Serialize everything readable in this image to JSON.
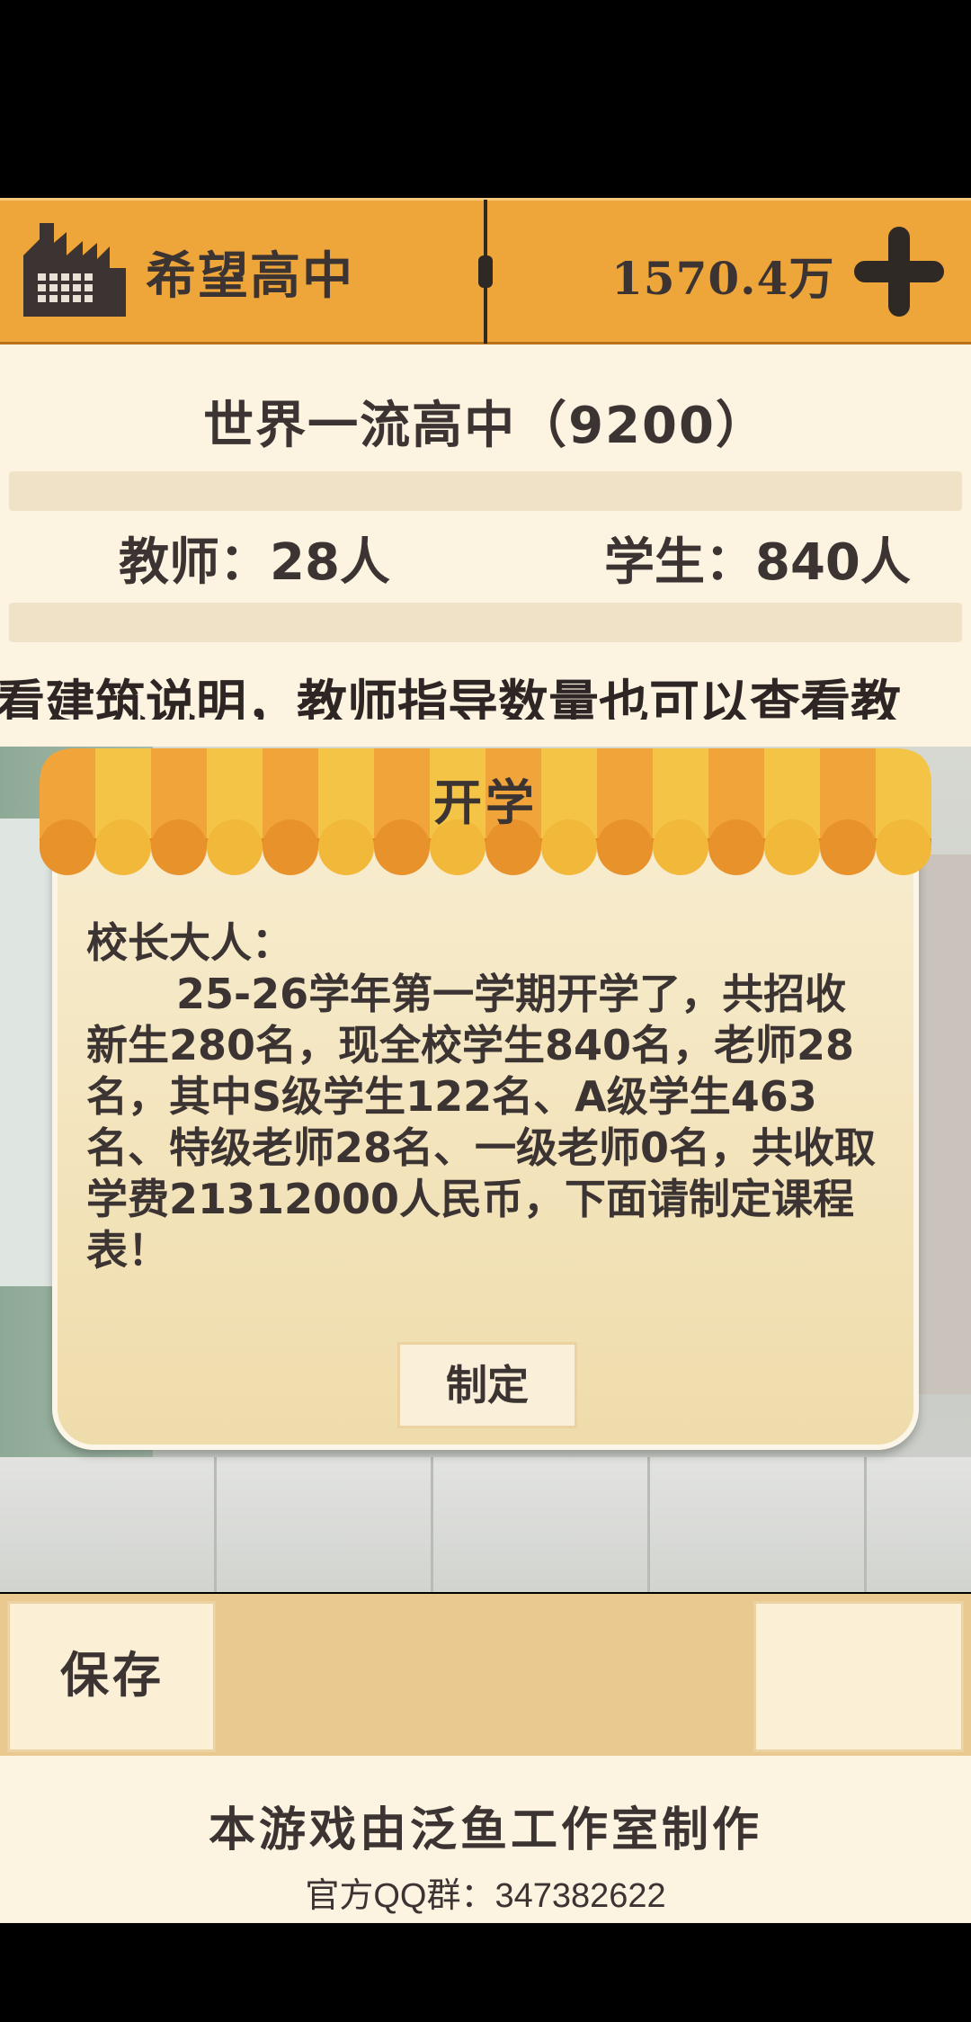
{
  "header": {
    "school_name": "希望高中",
    "money": "1570.4万",
    "icon_school": "factory-building-icon",
    "icon_add": "plus-icon"
  },
  "info": {
    "school_level": "世界一流高中（9200）",
    "teachers": "教师：28人",
    "students": "学生：840人",
    "marquee": "看建筑说明，教师指导数量也可以查看教"
  },
  "dialog": {
    "title": "开学",
    "greeting": "校长大人：",
    "body": "25-26学年第一学期开学了，共招收新生280名，现全校学生840名，老师28名，其中S级学生122名、A级学生463名、特级老师28名、一级老师0名，共收取学费21312000人民币，下面请制定课程表！",
    "confirm_label": "制定"
  },
  "bottom": {
    "save_label": "保存"
  },
  "footer": {
    "studio": "本游戏由泛鱼工作室制作",
    "qq": "官方QQ群：347382622"
  },
  "colors": {
    "header_orange": "#eea53a",
    "panel_cream": "#fcf4e1",
    "text_dark": "#3b3432",
    "awning_orange": "#f0a43a",
    "awning_yellow": "#f3c445"
  }
}
